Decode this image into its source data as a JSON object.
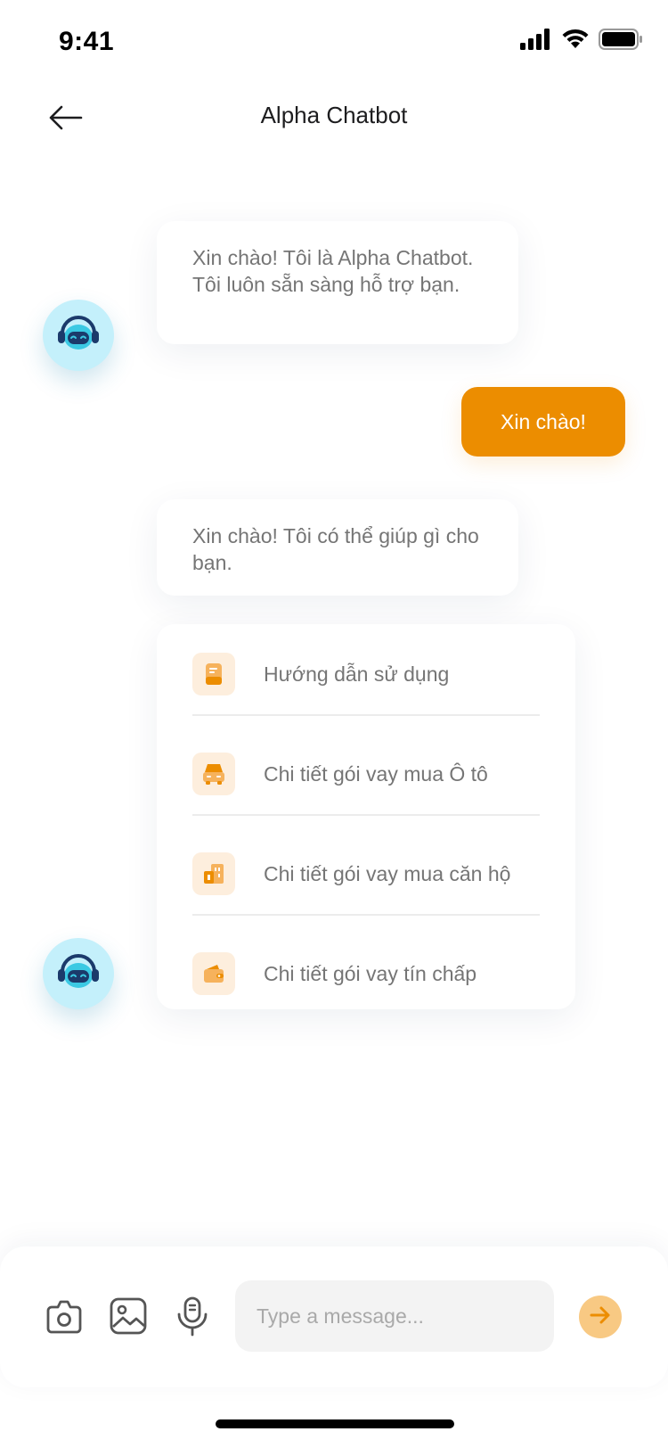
{
  "status_bar": {
    "time": "9:41",
    "icons": [
      "cellular-signal-icon",
      "wifi-icon",
      "battery-icon"
    ]
  },
  "header": {
    "back_icon": "arrow-left-icon",
    "title": "Alpha Chatbot"
  },
  "messages": [
    {
      "sender": "bot",
      "text": "Xin chào! Tôi là Alpha Chatbot. Tôi luôn sẵn sàng hỗ trợ bạn."
    },
    {
      "sender": "user",
      "text": "Xin chào!"
    },
    {
      "sender": "bot",
      "text": "Xin chào! Tôi có thể giúp gì cho bạn."
    }
  ],
  "options": [
    {
      "label": "Hướng dẫn sử dụng",
      "icon": "document-icon"
    },
    {
      "label": "Chi tiết gói vay mua Ô tô",
      "icon": "car-icon"
    },
    {
      "label": "Chi tiết gói vay mua căn hộ",
      "icon": "building-icon"
    },
    {
      "label": "Chi tiết gói vay tín chấp",
      "icon": "wallet-icon"
    }
  ],
  "composer": {
    "tools": [
      "camera-icon",
      "image-icon",
      "microphone-icon"
    ],
    "placeholder": "Type a message...",
    "send_icon": "arrow-right-icon"
  },
  "colors": {
    "accent": "#ec8d00",
    "send_button": "#f8c983",
    "option_icon_bg": "#fdeedd",
    "avatar_bg": "#c4f0fb",
    "input_bg": "#f3f3f3"
  }
}
